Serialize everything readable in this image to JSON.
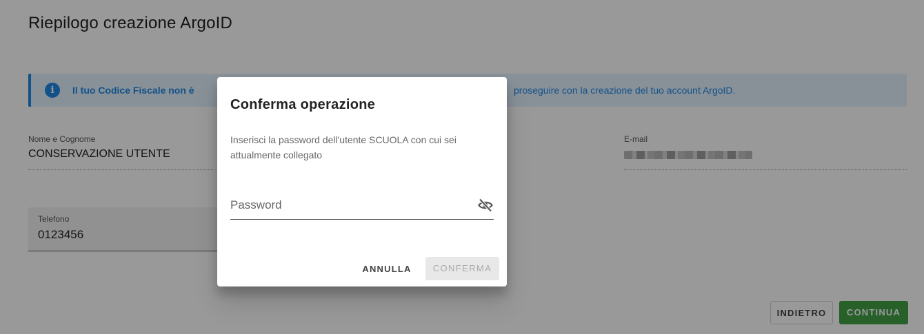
{
  "page": {
    "title": "Riepilogo creazione ArgoID",
    "alert": {
      "text_bold": "Il tuo Codice Fiscale non è",
      "text_rest": "proseguire con la creazione del tuo account ArgoID.",
      "icon": "info-icon"
    },
    "fields": {
      "name": {
        "label": "Nome e Cognome",
        "value": "CONSERVAZIONE UTENTE"
      },
      "email": {
        "label": "E-mail",
        "value_redacted": true
      },
      "phone": {
        "label": "Telefono",
        "value": "0123456"
      }
    },
    "buttons": {
      "back": "INDIETRO",
      "continue": "CONTINUA"
    }
  },
  "dialog": {
    "title": "Conferma operazione",
    "message": "Inserisci la password dell'utente SCUOLA con cui sei attualmente collegato",
    "password": {
      "placeholder": "Password",
      "value": "",
      "toggle_icon": "eye-off-icon"
    },
    "buttons": {
      "cancel": "ANNULLA",
      "confirm": "CONFERMA"
    }
  },
  "colors": {
    "info_blue": "#1e88e5",
    "alert_bg": "#e3f2fd",
    "continue_green": "#43a047",
    "overlay": "rgba(0,0,0,0.40)"
  }
}
